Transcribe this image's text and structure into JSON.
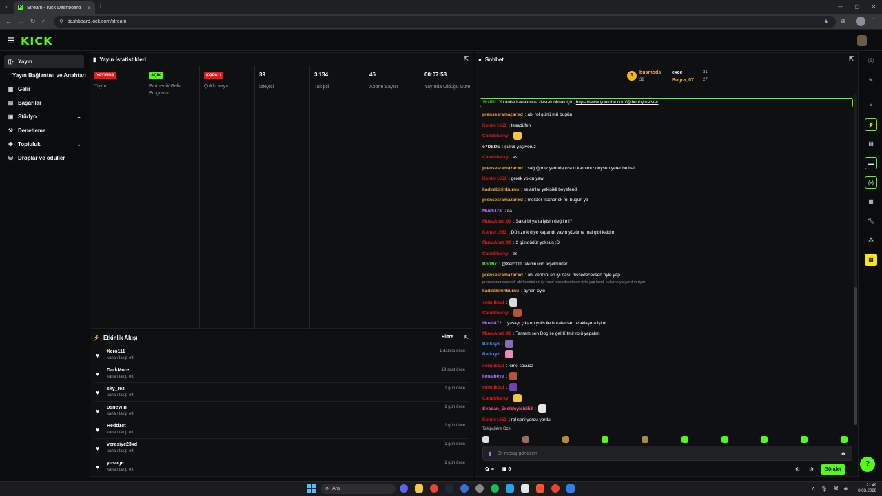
{
  "browser": {
    "tab_title": "Stream - Kick Dashboard",
    "tab_favicon": "K",
    "url": "dashboard.kick.com/stream"
  },
  "brand": {
    "logo": "KICK",
    "accent": "#53fc18"
  },
  "sidebar": {
    "items": [
      {
        "label": "Yayın",
        "icon": "broadcast-icon"
      },
      {
        "label": "Yayın Bağlantısı ve Anahtarı"
      },
      {
        "label": "Gelir",
        "icon": "revenue-icon"
      },
      {
        "label": "Başarılar",
        "icon": "achievements-icon"
      },
      {
        "label": "Stüdyo",
        "icon": "studio-icon"
      },
      {
        "label": "Denetleme",
        "icon": "moderation-icon"
      },
      {
        "label": "Topluluk",
        "icon": "community-icon"
      },
      {
        "label": "Droplar ve ödüller",
        "icon": "drops-icon"
      }
    ]
  },
  "stats_panel": {
    "title": "Yayın İstatistikleri",
    "columns": [
      {
        "badge": "YAYINDA",
        "label": "Yayın"
      },
      {
        "badge": "AÇIK",
        "label": "Partnerlik Gelir Programı"
      },
      {
        "badge": "KAPALI",
        "label": "Çoklu Yayın"
      },
      {
        "value": "39",
        "label": "İzleyici"
      },
      {
        "value": "3.134",
        "label": "Takipçi"
      },
      {
        "value": "46",
        "label": "Abone Sayısı"
      },
      {
        "value": "00:07:58",
        "label": "Yayında Olduğu Süre"
      }
    ]
  },
  "activity_panel": {
    "title": "Etkinlik Akışı",
    "filter_label": "Filtre",
    "rows": [
      {
        "name": "Xero111",
        "sub": "kanalı takip etti",
        "time": "1 dakika önce"
      },
      {
        "name": "DarkMore",
        "sub": "kanalı takip etti",
        "time": "19 saat önce"
      },
      {
        "name": "sky_rez",
        "sub": "kanalı takip etti",
        "time": "1 gün önce"
      },
      {
        "name": "osneynn",
        "sub": "kanalı takip etti",
        "time": "1 gün önce"
      },
      {
        "name": "Redd1ct",
        "sub": "kanalı takip etti",
        "time": "1 gün önce"
      },
      {
        "name": "veresiye23xd",
        "sub": "kanalı takip etti",
        "time": "1 gün önce"
      },
      {
        "name": "yusuge",
        "sub": "kanalı takip etti",
        "time": "1 gün önce"
      }
    ]
  },
  "chat_panel": {
    "title": "Sohbet",
    "leaderboard": {
      "first": {
        "rank": "1",
        "name": "busmods",
        "count": "38"
      },
      "second": {
        "name": "exee",
        "count": "31"
      },
      "third": {
        "name": "Bugra_07",
        "count": "27"
      }
    },
    "pinned": {
      "user": "BotRix",
      "text": ": Youtube kanalımıza destek olmak için; ",
      "link": "https://www.youtube.com/@bobbymeister"
    },
    "messages": [
      {
        "user": "prensesramazanxd",
        "color": "#f2a93b",
        "text": ": abi rol günü mü bugün",
        "emote": ""
      },
      {
        "user": "Kenter1653",
        "color": "#e91916",
        "text": ": tesadüfen",
        "emote": ""
      },
      {
        "user": "CaneSharky",
        "color": "#e91916",
        "text": ":",
        "emote": "#f5c542"
      },
      {
        "user": "o7DEDE",
        "color": "#d6d6d6",
        "text": ": şükür yaşıyoruz",
        "emote": ""
      },
      {
        "user": "CaneSharky",
        "color": "#e91916",
        "text": ": as",
        "emote": ""
      },
      {
        "user": "prensesramazanxd",
        "color": "#f2a93b",
        "text": ": sağlığımız yerinde olsun karnımız doysun yeter be bai",
        "emote": ""
      },
      {
        "user": "Kenter1653",
        "color": "#e91916",
        "text": ": gerek yoktu yaw",
        "emote": ""
      },
      {
        "user": "kadirabininburnu",
        "color": "#f2a93b",
        "text": ": selamlar yakisikli beyefendi",
        "emote": ""
      },
      {
        "user": "prensesramazanxd",
        "color": "#f2a93b",
        "text": ": meister fischer ck mı bugün ya",
        "emote": ""
      },
      {
        "user": "Musti472'",
        "color": "#b86bff",
        "text": ": sa",
        "emote": ""
      },
      {
        "user": "MusaAnat_90",
        "color": "#e91916",
        "text": ": Şaka bi yana iyisin değil mi?",
        "emote": ""
      },
      {
        "user": "Kenter1653",
        "color": "#e91916",
        "text": ": Dün zınk diye kapandı yayın yüzüme mal gibi kaldım",
        "emote": ""
      },
      {
        "user": "MusaAnat_90",
        "color": "#e91916",
        "text": ": 2 gündüdür yoksun :D",
        "emote": ""
      },
      {
        "user": "CaneSharky",
        "color": "#e91916",
        "text": ": as",
        "emote": ""
      },
      {
        "user": "BotRix",
        "color": "#53fc18",
        "text": ": @Xero111 takibin için teşekkürler!",
        "emote": ""
      },
      {
        "user": "prensesramazanxd",
        "color": "#f2a93b",
        "text": ": abi kendini en iyi nasıl hissedeceksen öyle yap",
        "emote": ""
      },
      {
        "user": "kadirabininburnu",
        "color": "#f2a93b",
        "text": ": aynen oyle",
        "emote": ""
      },
      {
        "user": "selenikbal",
        "color": "#e91916",
        "text": ":",
        "emote": "#d9d9d9"
      },
      {
        "user": "CaneSharky",
        "color": "#e91916",
        "text": ":",
        "emote": "#b5523b"
      },
      {
        "user": "Musti472'",
        "color": "#b86bff",
        "text": ": yasayı çıkarıp yulis ile buralardan uzaklaşma işimi",
        "emote": ""
      },
      {
        "user": "MusaAnat_90",
        "color": "#e91916",
        "text": ": Tamam sen Dog ile gel Kıtmir rolü yapalım",
        "emote": ""
      },
      {
        "user": "Berkxyz",
        "color": "#4d8cff",
        "text": ":",
        "emote": "#8a6bb8"
      },
      {
        "user": "Berkxyz",
        "color": "#4d8cff",
        "text": ":",
        "emote": "#e88bb5"
      },
      {
        "user": "selenikbal",
        "color": "#e91916",
        "text": ": kime sovuoz",
        "emote": ""
      },
      {
        "user": "kenalbeyy",
        "color": "#b86bff",
        "text": ":",
        "emote": "#b5523b"
      },
      {
        "user": "selenikbal",
        "color": "#e91916",
        "text": ":",
        "emote": "#7b3bb5"
      },
      {
        "user": "CaneSharky",
        "color": "#e91916",
        "text": ":",
        "emote": "#f5c542"
      },
      {
        "user": "Siradan_Exelzleyicisi52",
        "color": "#ff5c8a",
        "text": ":",
        "emote": "#e6e6e6"
      },
      {
        "user": "Kenter1653",
        "color": "#e91916",
        "text": ": rol seni yordu yordu",
        "emote": ""
      }
    ],
    "reply_context": "prensesramazanxd: abi kendini en iyi nasıl hissedeceksen öyle yap isimli kullanıcıya yanıt veriyor",
    "followers_only": "Takipçilere Özel",
    "input_placeholder": "Bir mesaj gönderin",
    "bottom_left_a": "∞",
    "bottom_left_b": "0",
    "send_label": "Gönder"
  },
  "taskbar": {
    "search": "Ara",
    "time": "21:49",
    "date": "8.03.2026"
  }
}
